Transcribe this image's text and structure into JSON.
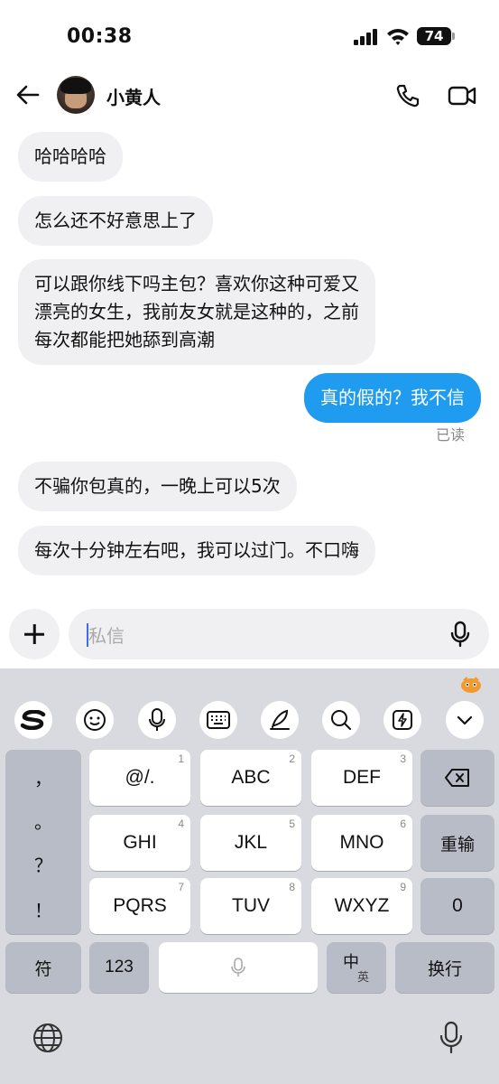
{
  "status_bar": {
    "time": "00:38",
    "battery": "74"
  },
  "header": {
    "contact_name": "小黄人"
  },
  "messages": [
    {
      "direction": "in",
      "text": "哈哈哈哈"
    },
    {
      "direction": "in",
      "text": "怎么还不好意思上了"
    },
    {
      "direction": "in",
      "lines": [
        "可以跟你线下吗主包？喜欢你这种可爱又",
        "漂亮的女生，我前友女就是这种的，之前",
        "每次都能把她舔到高潮"
      ]
    },
    {
      "direction": "out",
      "text": "真的假的？我不信"
    },
    {
      "direction": "in",
      "text": "不骗你包真的，一晚上可以5次"
    },
    {
      "direction": "in",
      "text": "每次十分钟左右吧，我可以过门。不口嗨"
    }
  ],
  "read_status": "已读",
  "composer": {
    "placeholder": "私信"
  },
  "keyboard": {
    "toolbar": [
      "sogou-logo-icon",
      "emoji-icon",
      "voice-icon",
      "keyboard-icon",
      "handwriting-icon",
      "search-icon",
      "quick-reply-icon",
      "collapse-icon"
    ],
    "side_punctuation": [
      "，",
      "。",
      "？",
      "！"
    ],
    "keys": [
      {
        "label": "@/.",
        "num": "1"
      },
      {
        "label": "ABC",
        "num": "2"
      },
      {
        "label": "DEF",
        "num": "3"
      },
      {
        "label": "GHI",
        "num": "4"
      },
      {
        "label": "JKL",
        "num": "5"
      },
      {
        "label": "MNO",
        "num": "6"
      },
      {
        "label": "PQRS",
        "num": "7"
      },
      {
        "label": "TUV",
        "num": "8"
      },
      {
        "label": "WXYZ",
        "num": "9"
      }
    ],
    "retype": "重输",
    "zero": "0",
    "symbols": "符",
    "numbers": "123",
    "lang_main": "中",
    "lang_alt": "英",
    "enter": "换行"
  },
  "colors": {
    "outgoing_bubble": "#1f9bf0",
    "incoming_bubble": "#f0f0f2",
    "keyboard_bg": "#d8dadf"
  }
}
